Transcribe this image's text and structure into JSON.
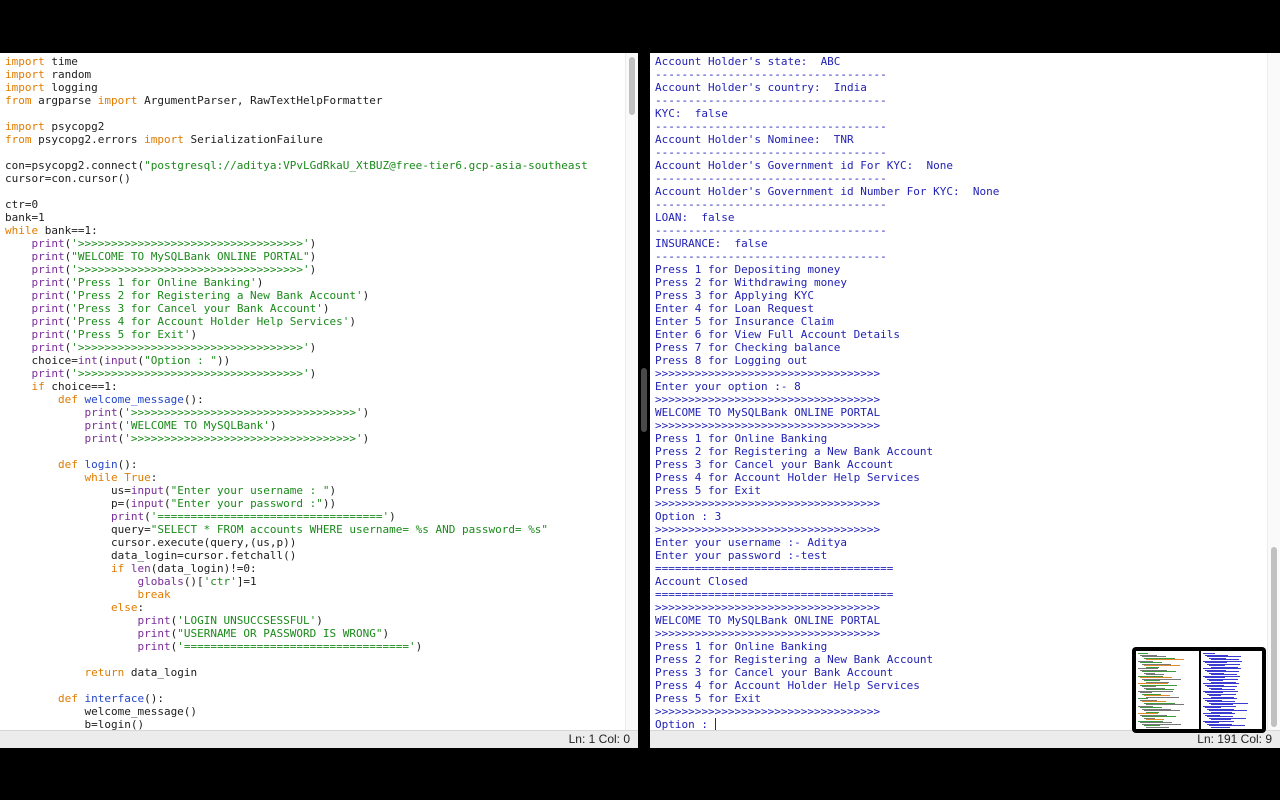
{
  "editor": {
    "lines": [
      [
        [
          "kw",
          "import"
        ],
        [
          "fn",
          " time"
        ]
      ],
      [
        [
          "kw",
          "import"
        ],
        [
          "fn",
          " random"
        ]
      ],
      [
        [
          "kw",
          "import"
        ],
        [
          "fn",
          " logging"
        ]
      ],
      [
        [
          "kw",
          "from"
        ],
        [
          "fn",
          " argparse "
        ],
        [
          "kw",
          "import"
        ],
        [
          "fn",
          " ArgumentParser, RawTextHelpFormatter"
        ]
      ],
      [],
      [
        [
          "kw",
          "import"
        ],
        [
          "fn",
          " psycopg2"
        ]
      ],
      [
        [
          "kw",
          "from"
        ],
        [
          "fn",
          " psycopg2.errors "
        ],
        [
          "kw",
          "import"
        ],
        [
          "fn",
          " SerializationFailure"
        ]
      ],
      [],
      [
        [
          "fn",
          "con=psycopg2.connect("
        ],
        [
          "str",
          "\"postgresql://aditya:VPvLGdRkaU_XtBUZ@free-tier6.gcp-asia-southeast"
        ]
      ],
      [
        [
          "fn",
          "cursor=con.cursor()"
        ]
      ],
      [],
      [
        [
          "fn",
          "ctr=0"
        ]
      ],
      [
        [
          "fn",
          "bank=1"
        ]
      ],
      [
        [
          "kw",
          "while"
        ],
        [
          "fn",
          " bank==1:"
        ]
      ],
      [
        [
          "fn",
          "    "
        ],
        [
          "bi",
          "print"
        ],
        [
          "fn",
          "("
        ],
        [
          "str",
          "'>>>>>>>>>>>>>>>>>>>>>>>>>>>>>>>>>>'"
        ],
        [
          "fn",
          ")"
        ]
      ],
      [
        [
          "fn",
          "    "
        ],
        [
          "bi",
          "print"
        ],
        [
          "fn",
          "("
        ],
        [
          "str",
          "\"WELCOME TO MySQLBank ONLINE PORTAL\""
        ],
        [
          "fn",
          ")"
        ]
      ],
      [
        [
          "fn",
          "    "
        ],
        [
          "bi",
          "print"
        ],
        [
          "fn",
          "("
        ],
        [
          "str",
          "'>>>>>>>>>>>>>>>>>>>>>>>>>>>>>>>>>>'"
        ],
        [
          "fn",
          ")"
        ]
      ],
      [
        [
          "fn",
          "    "
        ],
        [
          "bi",
          "print"
        ],
        [
          "fn",
          "("
        ],
        [
          "str",
          "'Press 1 for Online Banking'"
        ],
        [
          "fn",
          ")"
        ]
      ],
      [
        [
          "fn",
          "    "
        ],
        [
          "bi",
          "print"
        ],
        [
          "fn",
          "("
        ],
        [
          "str",
          "'Press 2 for Registering a New Bank Account'"
        ],
        [
          "fn",
          ")"
        ]
      ],
      [
        [
          "fn",
          "    "
        ],
        [
          "bi",
          "print"
        ],
        [
          "fn",
          "("
        ],
        [
          "str",
          "'Press 3 for Cancel your Bank Account'"
        ],
        [
          "fn",
          ")"
        ]
      ],
      [
        [
          "fn",
          "    "
        ],
        [
          "bi",
          "print"
        ],
        [
          "fn",
          "("
        ],
        [
          "str",
          "'Press 4 for Account Holder Help Services'"
        ],
        [
          "fn",
          ")"
        ]
      ],
      [
        [
          "fn",
          "    "
        ],
        [
          "bi",
          "print"
        ],
        [
          "fn",
          "("
        ],
        [
          "str",
          "'Press 5 for Exit'"
        ],
        [
          "fn",
          ")"
        ]
      ],
      [
        [
          "fn",
          "    "
        ],
        [
          "bi",
          "print"
        ],
        [
          "fn",
          "("
        ],
        [
          "str",
          "'>>>>>>>>>>>>>>>>>>>>>>>>>>>>>>>>>>'"
        ],
        [
          "fn",
          ")"
        ]
      ],
      [
        [
          "fn",
          "    choice="
        ],
        [
          "bi",
          "int"
        ],
        [
          "fn",
          "("
        ],
        [
          "bi",
          "input"
        ],
        [
          "fn",
          "("
        ],
        [
          "str",
          "\"Option : \""
        ],
        [
          "fn",
          "))"
        ]
      ],
      [
        [
          "fn",
          "    "
        ],
        [
          "bi",
          "print"
        ],
        [
          "fn",
          "("
        ],
        [
          "str",
          "'>>>>>>>>>>>>>>>>>>>>>>>>>>>>>>>>>>'"
        ],
        [
          "fn",
          ")"
        ]
      ],
      [
        [
          "fn",
          "    "
        ],
        [
          "kw",
          "if"
        ],
        [
          "fn",
          " choice==1:"
        ]
      ],
      [
        [
          "fn",
          "        "
        ],
        [
          "kw",
          "def"
        ],
        [
          "fn",
          " "
        ],
        [
          "def",
          "welcome_message"
        ],
        [
          "fn",
          "():"
        ]
      ],
      [
        [
          "fn",
          "            "
        ],
        [
          "bi",
          "print"
        ],
        [
          "fn",
          "("
        ],
        [
          "str",
          "'>>>>>>>>>>>>>>>>>>>>>>>>>>>>>>>>>>'"
        ],
        [
          "fn",
          ")"
        ]
      ],
      [
        [
          "fn",
          "            "
        ],
        [
          "bi",
          "print"
        ],
        [
          "fn",
          "("
        ],
        [
          "str",
          "'WELCOME TO MySQLBank'"
        ],
        [
          "fn",
          ")"
        ]
      ],
      [
        [
          "fn",
          "            "
        ],
        [
          "bi",
          "print"
        ],
        [
          "fn",
          "("
        ],
        [
          "str",
          "'>>>>>>>>>>>>>>>>>>>>>>>>>>>>>>>>>>'"
        ],
        [
          "fn",
          ")"
        ]
      ],
      [],
      [
        [
          "fn",
          "        "
        ],
        [
          "kw",
          "def"
        ],
        [
          "fn",
          " "
        ],
        [
          "def",
          "login"
        ],
        [
          "fn",
          "():"
        ]
      ],
      [
        [
          "fn",
          "            "
        ],
        [
          "kw",
          "while"
        ],
        [
          "fn",
          " "
        ],
        [
          "kw",
          "True"
        ],
        [
          "fn",
          ":"
        ]
      ],
      [
        [
          "fn",
          "                us="
        ],
        [
          "bi",
          "input"
        ],
        [
          "fn",
          "("
        ],
        [
          "str",
          "\"Enter your username : \""
        ],
        [
          "fn",
          ")"
        ]
      ],
      [
        [
          "fn",
          "                p=("
        ],
        [
          "bi",
          "input"
        ],
        [
          "fn",
          "("
        ],
        [
          "str",
          "\"Enter your password :\""
        ],
        [
          "fn",
          "))"
        ]
      ],
      [
        [
          "fn",
          "                "
        ],
        [
          "bi",
          "print"
        ],
        [
          "fn",
          "("
        ],
        [
          "str",
          "'=================================='"
        ],
        [
          "fn",
          ")"
        ]
      ],
      [
        [
          "fn",
          "                query="
        ],
        [
          "str",
          "\"SELECT * FROM accounts WHERE username= %s AND password= %s\""
        ]
      ],
      [
        [
          "fn",
          "                cursor.execute(query,(us,p))"
        ]
      ],
      [
        [
          "fn",
          "                data_login=cursor.fetchall()"
        ]
      ],
      [
        [
          "fn",
          "                "
        ],
        [
          "kw",
          "if"
        ],
        [
          "fn",
          " "
        ],
        [
          "bi",
          "len"
        ],
        [
          "fn",
          "(data_login)!=0:"
        ]
      ],
      [
        [
          "fn",
          "                    "
        ],
        [
          "bi",
          "globals"
        ],
        [
          "fn",
          "()["
        ],
        [
          "str",
          "'ctr'"
        ],
        [
          "fn",
          "]=1"
        ]
      ],
      [
        [
          "fn",
          "                    "
        ],
        [
          "kw",
          "break"
        ]
      ],
      [
        [
          "fn",
          "                "
        ],
        [
          "kw",
          "else"
        ],
        [
          "fn",
          ":"
        ]
      ],
      [
        [
          "fn",
          "                    "
        ],
        [
          "bi",
          "print"
        ],
        [
          "fn",
          "("
        ],
        [
          "str",
          "'LOGIN UNSUCCSESSFUL'"
        ],
        [
          "fn",
          ")"
        ]
      ],
      [
        [
          "fn",
          "                    "
        ],
        [
          "bi",
          "print"
        ],
        [
          "fn",
          "("
        ],
        [
          "str",
          "\"USERNAME OR PASSWORD IS WRONG\""
        ],
        [
          "fn",
          ")"
        ]
      ],
      [
        [
          "fn",
          "                    "
        ],
        [
          "bi",
          "print"
        ],
        [
          "fn",
          "("
        ],
        [
          "str",
          "'=================================='"
        ],
        [
          "fn",
          ")"
        ]
      ],
      [],
      [
        [
          "fn",
          "            "
        ],
        [
          "kw",
          "return"
        ],
        [
          "fn",
          " data_login"
        ]
      ],
      [],
      [
        [
          "fn",
          "        "
        ],
        [
          "kw",
          "def"
        ],
        [
          "fn",
          " "
        ],
        [
          "def",
          "interface"
        ],
        [
          "fn",
          "():"
        ]
      ],
      [
        [
          "fn",
          "            welcome_message()"
        ]
      ],
      [
        [
          "fn",
          "            b=login()"
        ]
      ]
    ],
    "status": "Ln: 1  Col: 0"
  },
  "terminal": {
    "lines": [
      "Account Holder's state:  ABC",
      "-----------------------------------",
      "Account Holder's country:  India",
      "-----------------------------------",
      "KYC:  false",
      "-----------------------------------",
      "Account Holder's Nominee:  TNR",
      "-----------------------------------",
      "Account Holder's Government id For KYC:  None",
      "-----------------------------------",
      "Account Holder's Government id Number For KYC:  None",
      "-----------------------------------",
      "LOAN:  false",
      "-----------------------------------",
      "INSURANCE:  false",
      "-----------------------------------",
      "Press 1 for Depositing money",
      "Press 2 for Withdrawing money",
      "Press 3 for Applying KYC",
      "Enter 4 for Loan Request",
      "Enter 5 for Insurance Claim",
      "Enter 6 for View Full Account Details",
      "Press 7 for Checking balance",
      "Press 8 for Logging out",
      ">>>>>>>>>>>>>>>>>>>>>>>>>>>>>>>>>>",
      "Enter your option :- 8",
      ">>>>>>>>>>>>>>>>>>>>>>>>>>>>>>>>>>",
      "WELCOME TO MySQLBank ONLINE PORTAL",
      ">>>>>>>>>>>>>>>>>>>>>>>>>>>>>>>>>>",
      "Press 1 for Online Banking",
      "Press 2 for Registering a New Bank Account",
      "Press 3 for Cancel your Bank Account",
      "Press 4 for Account Holder Help Services",
      "Press 5 for Exit",
      ">>>>>>>>>>>>>>>>>>>>>>>>>>>>>>>>>>",
      "Option : 3",
      ">>>>>>>>>>>>>>>>>>>>>>>>>>>>>>>>>>",
      "Enter your username :- Aditya",
      "Enter your password :-test",
      "====================================",
      "Account Closed",
      "====================================",
      ">>>>>>>>>>>>>>>>>>>>>>>>>>>>>>>>>>",
      "WELCOME TO MySQLBank ONLINE PORTAL",
      ">>>>>>>>>>>>>>>>>>>>>>>>>>>>>>>>>>",
      "Press 1 for Online Banking",
      "Press 2 for Registering a New Bank Account",
      "Press 3 for Cancel your Bank Account",
      "Press 4 for Account Holder Help Services",
      "Press 5 for Exit",
      ">>>>>>>>>>>>>>>>>>>>>>>>>>>>>>>>>>"
    ],
    "prompt": "Option : ",
    "status": "Ln: 191  Col: 9"
  }
}
